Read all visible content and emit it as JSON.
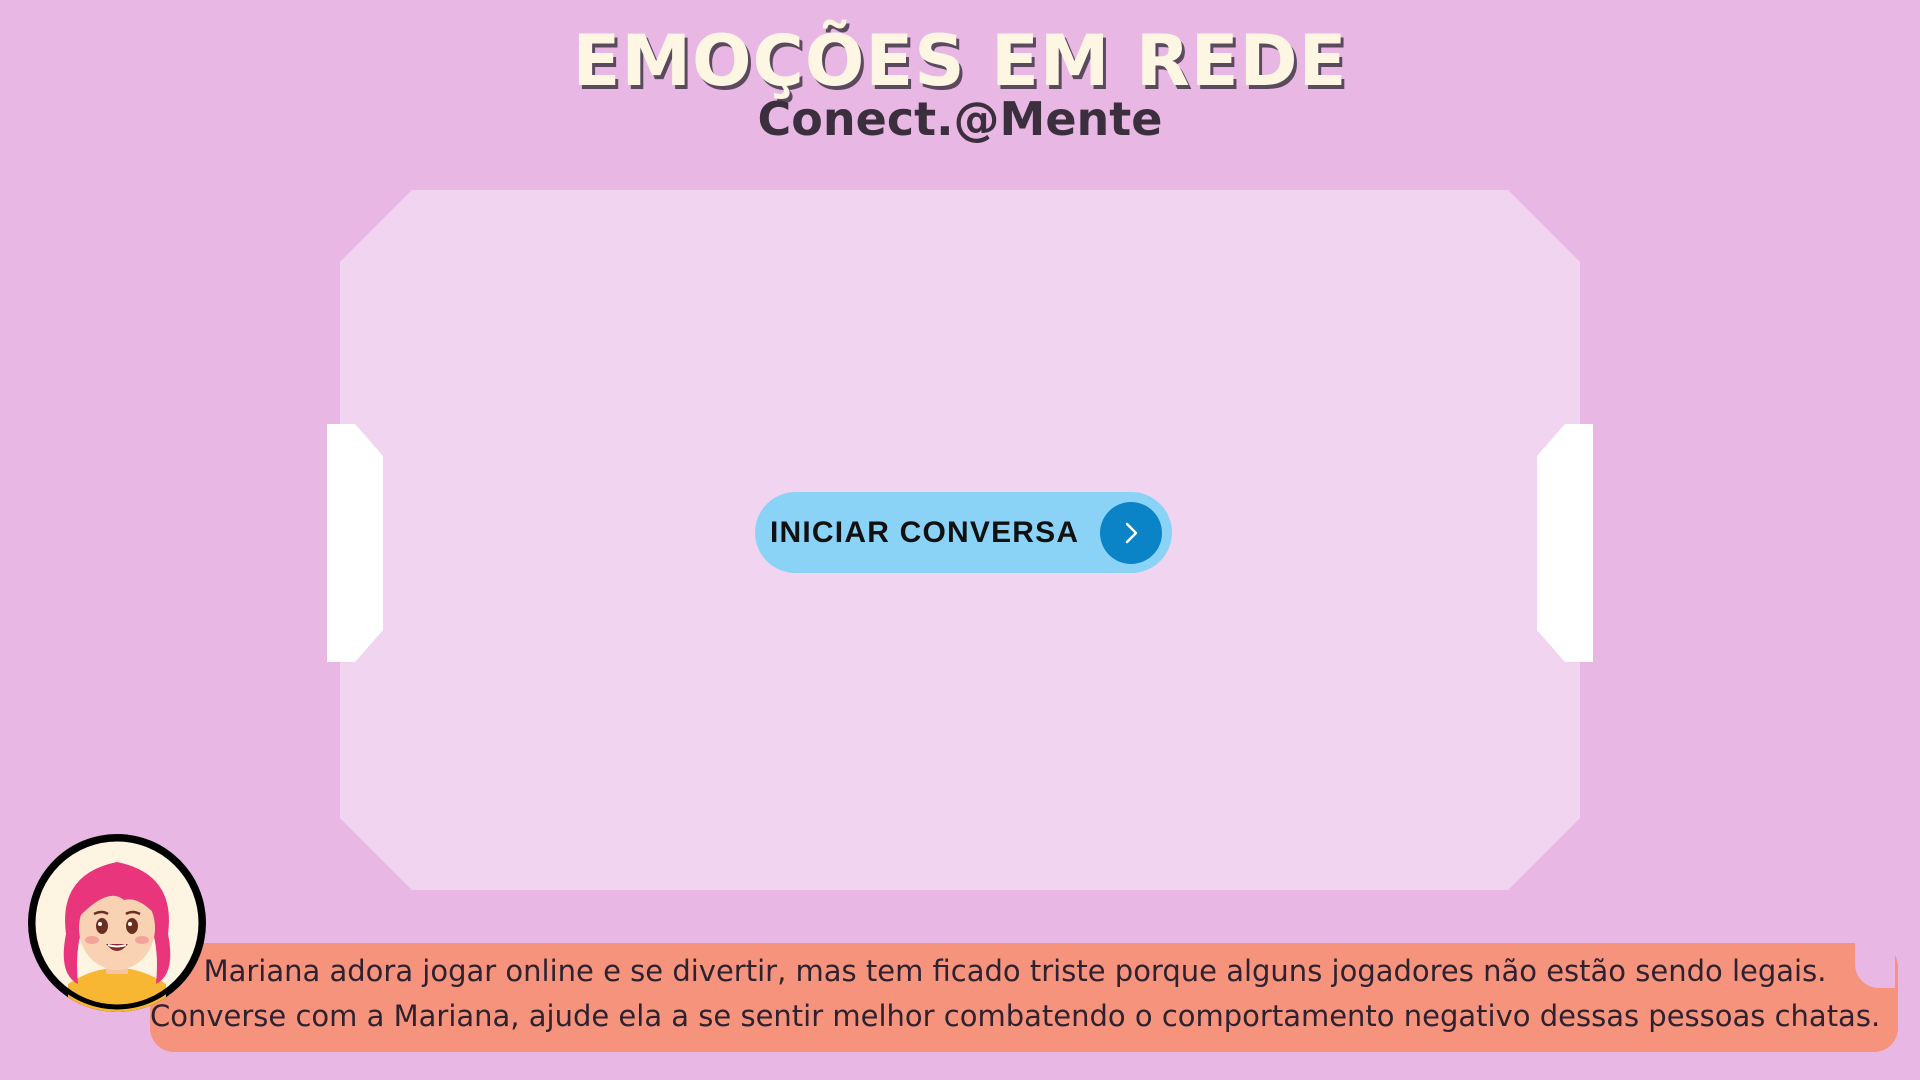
{
  "header": {
    "title": "EMOÇÕES EM REDE",
    "subtitle": "Conect.@Mente"
  },
  "main": {
    "start_button_label": "INICIAR CONVERSA",
    "start_button_icon": "chevron-right-icon"
  },
  "narration": {
    "avatar": "girl-avatar-pink-hair",
    "line1": "Mariana adora jogar online e se divertir, mas tem ficado triste porque alguns jogadores não estão sendo legais.",
    "line2": "Converse com a Mariana, ajude ela a se sentir melhor combatendo o comportamento negativo dessas pessoas chatas."
  },
  "colors": {
    "background": "#e8b7e4",
    "panel": "#f1d5f0",
    "button": "#8ad3f7",
    "button_circle": "#0a84c6",
    "speech_bubble": "#f5937d",
    "title": "#fdf6e3"
  }
}
